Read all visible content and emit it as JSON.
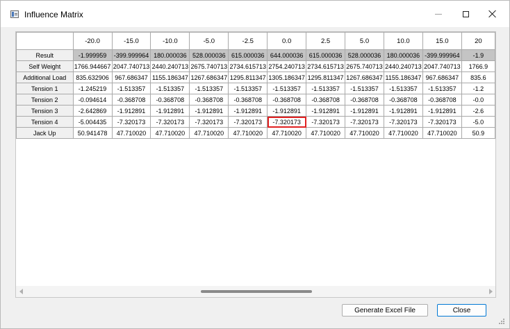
{
  "window": {
    "title": "Influence Matrix"
  },
  "table": {
    "columns": [
      "-20.0",
      "-15.0",
      "-10.0",
      "-5.0",
      "-2.5",
      "0.0",
      "2.5",
      "5.0",
      "10.0",
      "15.0",
      "20"
    ],
    "rows": [
      {
        "label": "Result",
        "cells": [
          "-1.999959",
          "-399.999964",
          "180.000036",
          "528.000036",
          "615.000036",
          "644.000036",
          "615.000036",
          "528.000036",
          "180.000036",
          "-399.999964",
          "-1.9"
        ]
      },
      {
        "label": "Self Weight",
        "cells": [
          "1766.944667",
          "2047.740713",
          "2440.240713",
          "2675.740713",
          "2734.615713",
          "2754.240713",
          "2734.615713",
          "2675.740713",
          "2440.240713",
          "2047.740713",
          "1766.9"
        ]
      },
      {
        "label": "Additional Load",
        "cells": [
          "835.632906",
          "967.686347",
          "1155.186347",
          "1267.686347",
          "1295.811347",
          "1305.186347",
          "1295.811347",
          "1267.686347",
          "1155.186347",
          "967.686347",
          "835.6"
        ]
      },
      {
        "label": "Tension 1",
        "cells": [
          "-1.245219",
          "-1.513357",
          "-1.513357",
          "-1.513357",
          "-1.513357",
          "-1.513357",
          "-1.513357",
          "-1.513357",
          "-1.513357",
          "-1.513357",
          "-1.2"
        ]
      },
      {
        "label": "Tension 2",
        "cells": [
          "-0.094614",
          "-0.368708",
          "-0.368708",
          "-0.368708",
          "-0.368708",
          "-0.368708",
          "-0.368708",
          "-0.368708",
          "-0.368708",
          "-0.368708",
          "-0.0"
        ]
      },
      {
        "label": "Tension 3",
        "cells": [
          "-2.642869",
          "-1.912891",
          "-1.912891",
          "-1.912891",
          "-1.912891",
          "-1.912891",
          "-1.912891",
          "-1.912891",
          "-1.912891",
          "-1.912891",
          "-2.6"
        ]
      },
      {
        "label": "Tension 4",
        "cells": [
          "-5.004435",
          "-7.320173",
          "-7.320173",
          "-7.320173",
          "-7.320173",
          "-7.320173",
          "-7.320173",
          "-7.320173",
          "-7.320173",
          "-7.320173",
          "-5.0"
        ]
      },
      {
        "label": "Jack Up",
        "cells": [
          "50.941478",
          "47.710020",
          "47.710020",
          "47.710020",
          "47.710020",
          "47.710020",
          "47.710020",
          "47.710020",
          "47.710020",
          "47.710020",
          "50.9"
        ]
      }
    ],
    "selected_cell": {
      "row": 6,
      "col": 5
    },
    "result_row_bg": "#c4c4c4",
    "selection_color": "#e02020"
  },
  "buttons": {
    "generate_excel": "Generate Excel File",
    "close": "Close"
  },
  "icons": {
    "app": "app-window-icon",
    "minimize": "minimize-icon",
    "maximize": "maximize-icon",
    "close": "close-icon"
  }
}
